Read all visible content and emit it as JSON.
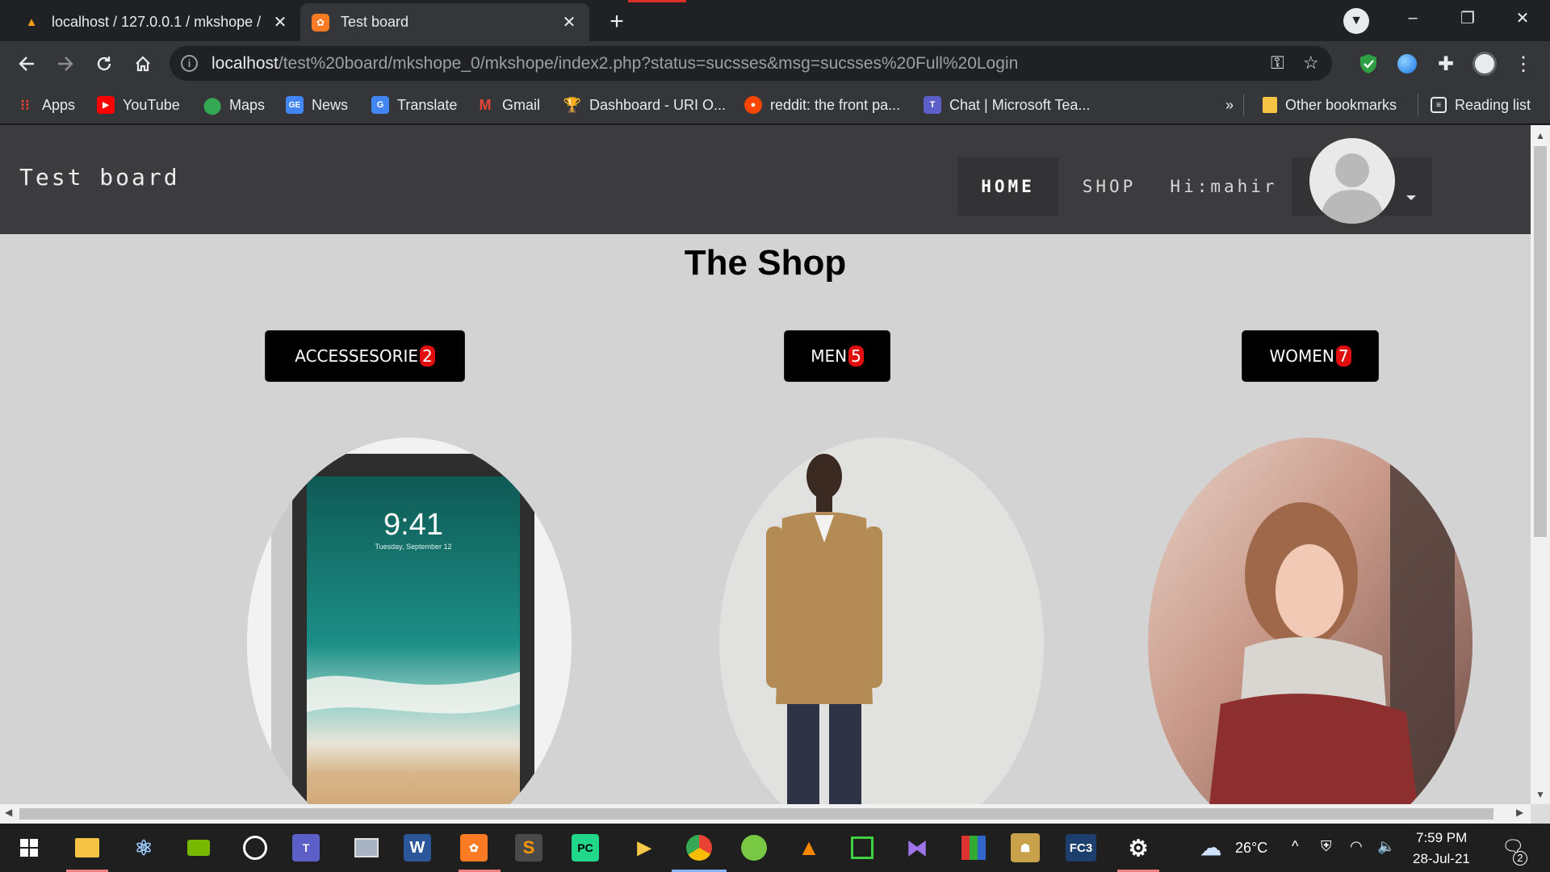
{
  "browser": {
    "tabs": [
      {
        "title": "localhost / 127.0.0.1 / mkshope /",
        "favicon": "phpmyadmin-icon",
        "active": false
      },
      {
        "title": "Test board",
        "favicon": "xampp-icon",
        "active": true
      }
    ],
    "url": {
      "host": "localhost",
      "path": "/test%20board/mkshope_0/mkshope/index2.php?status=sucsses&msg=sucsses%20Full%20Login"
    },
    "bookmarks": [
      {
        "label": "Apps",
        "icon": "apps-grid-icon"
      },
      {
        "label": "YouTube",
        "icon": "youtube-icon"
      },
      {
        "label": "Maps",
        "icon": "maps-pin-icon"
      },
      {
        "label": "News",
        "icon": "news-icon"
      },
      {
        "label": "Translate",
        "icon": "translate-icon"
      },
      {
        "label": "Gmail",
        "icon": "gmail-icon"
      },
      {
        "label": "Dashboard - URI O...",
        "icon": "trophy-icon"
      },
      {
        "label": "reddit: the front pa...",
        "icon": "reddit-icon"
      },
      {
        "label": "Chat | Microsoft Tea...",
        "icon": "teams-icon"
      }
    ],
    "overflow_chevron": "»",
    "other_bookmarks": "Other bookmarks",
    "reading_list": "Reading list"
  },
  "site": {
    "brand": "Test board",
    "nav": {
      "home": "HOME",
      "shop": "SHOP",
      "user": "Hi:mahir"
    },
    "page_title": "The Shop",
    "categories": [
      {
        "label": "ACCESSESORIE",
        "count": "2",
        "image": "tablet-product-image"
      },
      {
        "label": "MEN",
        "count": "5",
        "image": "men-jacket-model-image"
      },
      {
        "label": "WOMEN",
        "count": "7",
        "image": "woman-scarf-model-image"
      }
    ],
    "tablet_time": "9:41",
    "tablet_date": "Tuesday, September 12"
  },
  "taskbar": {
    "weather": "26°C",
    "time": "7:59 PM",
    "date": "28-Jul-21",
    "notifications": "2",
    "apps": [
      "windows-start-icon",
      "file-explorer-icon",
      "atom-icon",
      "nvidia-icon",
      "obs-icon",
      "teams-icon",
      "photos-icon",
      "word-icon",
      "xampp-icon",
      "sublime-icon",
      "pycharm-icon",
      "media-player-icon",
      "chrome-icon",
      "utorrent-icon",
      "vlc-icon",
      "cpu-z-icon",
      "visual-studio-icon",
      "winrar-icon",
      "game-icon",
      "fc3-icon",
      "settings-icon"
    ]
  },
  "colors": {
    "chrome_dark": "#202124",
    "chrome_toolbar": "#35363a",
    "site_nav": "#3c3c3e",
    "page_bg": "#d3d3d3",
    "badge_red": "#e20e0e"
  }
}
